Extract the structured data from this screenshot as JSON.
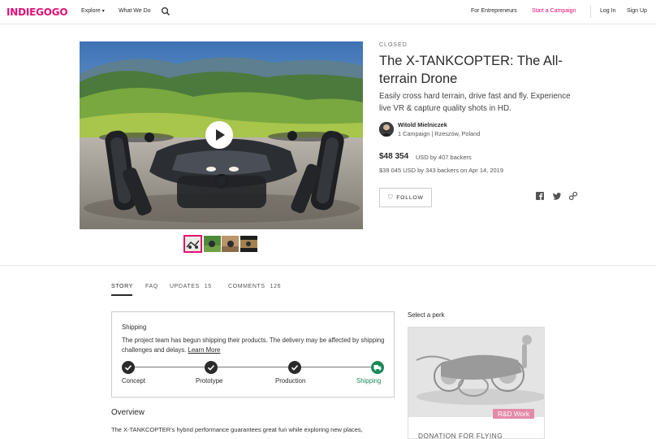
{
  "nav": {
    "logo": "INDIEGOGO",
    "explore": "Explore",
    "what_we_do": "What We Do",
    "for_entrepreneurs": "For Entrepreneurs",
    "start_campaign": "Start a Campaign",
    "log_in": "Log In",
    "sign_up": "Sign Up"
  },
  "campaign": {
    "status": "CLOSED",
    "title": "The X-TANKCOPTER: The All-terrain Drone",
    "tagline": "Easily cross hard terrain, drive fast and fly. Experience live VR & capture quality shots in HD.",
    "owner_name": "Witold Mielniczek",
    "owner_meta": "1 Campaign | Rzeszów, Poland",
    "raised_amount": "$48 354",
    "raised_meta": "USD by 407 backers",
    "prior_funding": "$39 045 USD by 343 backers on Apr 14, 2019",
    "follow_label": "FOLLOW"
  },
  "tabs": [
    {
      "label": "STORY",
      "count": ""
    },
    {
      "label": "FAQ",
      "count": ""
    },
    {
      "label": "UPDATES",
      "count": "15"
    },
    {
      "label": "COMMENTS",
      "count": "126"
    }
  ],
  "shipping": {
    "title": "Shipping",
    "text": "The project team has begun shipping their products. The delivery may be affected by shipping challenges and delays.",
    "learn_more": "Learn More",
    "steps": [
      "Concept",
      "Prototype",
      "Production",
      "Shipping"
    ]
  },
  "story": {
    "overview_heading": "Overview",
    "first_line": "The X-TANKCOPTER's hybrid performance guarantees great fun while exploring new places,"
  },
  "perk": {
    "heading": "Select a perk",
    "badge": "R&D Work",
    "title": "DONATION FOR FLYING"
  },
  "colors": {
    "brand": "#e51075",
    "success": "#1a8a5a"
  }
}
